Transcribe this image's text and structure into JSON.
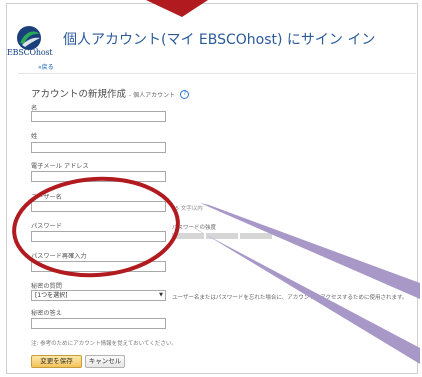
{
  "header": {
    "title": "個人アカウント(マイ EBSCOhost) にサイン イン",
    "logo_text": "EBSCOhost",
    "back_link": "«戻る"
  },
  "form": {
    "heading": "アカウントの新規作成",
    "heading_sub": "- 個人アカウント",
    "help_glyph": "?",
    "first_name_label": "名",
    "last_name_label": "姓",
    "email_label": "電子メール アドレス",
    "username_label": "ユーザー名",
    "username_note": "25 文字以内",
    "password_label": "パスワード",
    "password_strength_label": "パスワードの強度",
    "password_note": "",
    "password_confirm_label": "パスワード再確入力",
    "secret_question_label": "秘密の質問",
    "secret_question_value": "[1つを選択]",
    "secret_question_note": "ユーザー名またはパスワードを忘れた場合に、アカウントにアクセスするために使用されます。",
    "secret_answer_label": "秘密の答え",
    "footer_note": "注: 参考のためにアカウント情報を覚えておいてください。",
    "save_button": "変更を保存",
    "cancel_button": "キャンセル"
  },
  "colors": {
    "annotation_red": "#b11a1f",
    "annotation_purple": "#a898c8",
    "title_blue": "#2a5a98",
    "link_blue": "#0a5bbd"
  },
  "icons": {
    "logo": "ebsco-logo-icon",
    "help": "help-icon",
    "dropdown": "chevron-down-icon"
  }
}
